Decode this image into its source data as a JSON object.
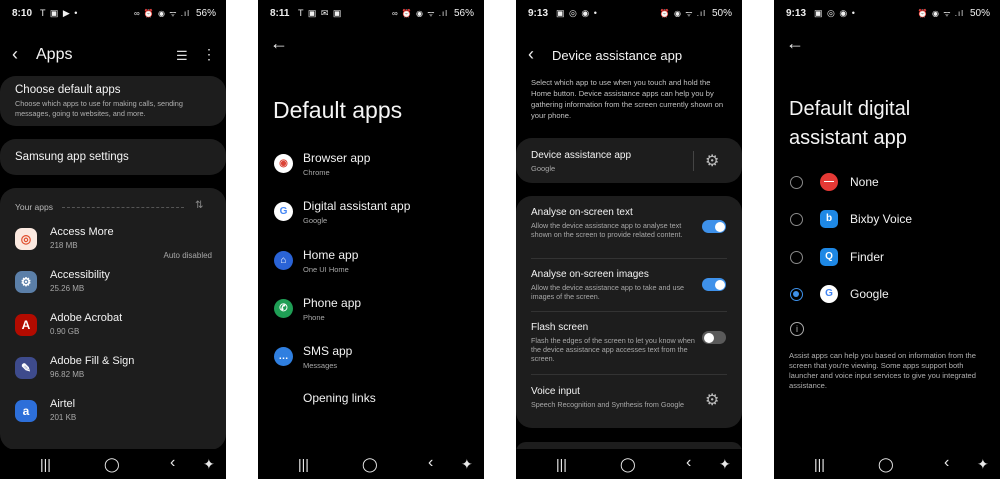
{
  "screen1": {
    "status": {
      "time": "8:10",
      "left_icons": "T ▣ ▶ •",
      "right_icons": "∞ ⏰ ◉ ᯤ .ıl",
      "battery": "56%"
    },
    "title": "Apps",
    "choose_default": {
      "title": "Choose default apps",
      "desc": "Choose which apps to use for making calls, sending messages, going to websites, and more."
    },
    "samsung_settings": "Samsung app settings",
    "your_apps_label": "Your apps",
    "apps": [
      {
        "name": "Access More",
        "size": "218 MB",
        "status": "Auto disabled",
        "color": "#fbe9e0",
        "glyph": "◎"
      },
      {
        "name": "Accessibility",
        "size": "25.26 MB",
        "status": "",
        "color": "#5b7fa8",
        "glyph": "⚙"
      },
      {
        "name": "Adobe Acrobat",
        "size": "0.90 GB",
        "status": "",
        "color": "#b30b00",
        "glyph": "A"
      },
      {
        "name": "Adobe Fill & Sign",
        "size": "96.82 MB",
        "status": "",
        "color": "#3e4b8c",
        "glyph": "✎"
      },
      {
        "name": "Airtel",
        "size": "201 KB",
        "status": "",
        "color": "#2d6fd9",
        "glyph": "a"
      }
    ]
  },
  "screen2": {
    "status": {
      "time": "8:11",
      "left_icons": "T ▣ ✉ ▣",
      "right_icons": "∞ ⏰ ◉ ᯤ .ıl",
      "battery": "56%"
    },
    "title": "Default apps",
    "items": [
      {
        "name": "Browser app",
        "sub": "Chrome",
        "bg": "#ffffff",
        "fg": "#db4437",
        "glyph": "◉"
      },
      {
        "name": "Digital assistant app",
        "sub": "Google",
        "bg": "#ffffff",
        "fg": "#4285f4",
        "glyph": "G"
      },
      {
        "name": "Home app",
        "sub": "One UI Home",
        "bg": "#2a63d6",
        "fg": "#ffffff",
        "glyph": "⌂"
      },
      {
        "name": "Phone app",
        "sub": "Phone",
        "bg": "#1f9e55",
        "fg": "#ffffff",
        "glyph": "✆"
      },
      {
        "name": "SMS app",
        "sub": "Messages",
        "bg": "#2f7fe0",
        "fg": "#ffffff",
        "glyph": "…"
      }
    ],
    "opening_links": "Opening links"
  },
  "screen3": {
    "status": {
      "time": "9:13",
      "left_icons": "▣ ◎ ◉ •",
      "right_icons": "⏰ ◉ ᯤ .ıl",
      "battery": "50%"
    },
    "title": "Device assistance app",
    "description": "Select which app to use when you touch and hold the Home button. Device assistance apps can help you by gathering information from the screen currently shown on your phone.",
    "device_app": {
      "title": "Device assistance app",
      "value": "Google"
    },
    "settings": [
      {
        "title": "Analyse on-screen text",
        "desc": "Allow the device assistance app to analyse text shown on the screen to provide related content.",
        "on": true
      },
      {
        "title": "Analyse on-screen images",
        "desc": "Allow the device assistance app to take and use images of the screen.",
        "on": true
      },
      {
        "title": "Flash screen",
        "desc": "Flash the edges of the screen to let you know when the device assistance app accesses text from the screen.",
        "on": false
      }
    ],
    "voice_input": {
      "title": "Voice input",
      "desc": "Speech Recognition and Synthesis from Google"
    }
  },
  "screen4": {
    "status": {
      "time": "9:13",
      "left_icons": "▣ ◎ ◉ •",
      "right_icons": "⏰ ◉ ᯤ .ıl",
      "battery": "50%"
    },
    "title": "Default digital assistant app",
    "options": [
      {
        "label": "None",
        "selected": false,
        "bg": "#e53935",
        "fg": "#ffffff",
        "glyph": "—",
        "radius": "50%"
      },
      {
        "label": "Bixby Voice",
        "selected": false,
        "bg": "#1e88e5",
        "fg": "#ffffff",
        "glyph": "b",
        "radius": "5px"
      },
      {
        "label": "Finder",
        "selected": false,
        "bg": "#1e88e5",
        "fg": "#ffffff",
        "glyph": "Q",
        "radius": "5px"
      },
      {
        "label": "Google",
        "selected": true,
        "bg": "#ffffff",
        "fg": "#4285f4",
        "glyph": "G",
        "radius": "50%"
      }
    ],
    "info_text": "Assist apps can help you based on information from the screen that you're viewing. Some apps support both launcher and voice input services to give you integrated assistance."
  },
  "nav": {
    "recent": "|||",
    "home": "◯",
    "back": "‹",
    "accessibility": "✦"
  }
}
